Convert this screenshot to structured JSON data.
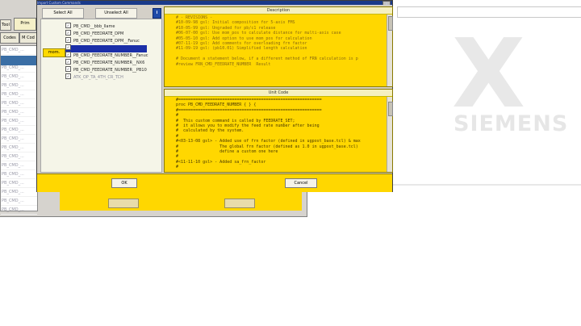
{
  "background_window": {
    "toolbar_left_label": "Tool",
    "prim_label": "Prim",
    "codes_label": "Codes",
    "mcod_label": "M Cod",
    "list_items": [
      "PB_CMD_...",
      "PB_CMD_...",
      "PB_CMD_...",
      "PB_CMD_...",
      "PB_CMD_...",
      "PB_CMD_...",
      "PB_CMD_...",
      "PB_CMD_...",
      "PB_CMD_...",
      "PB_CMD_...",
      "PB_CMD_...",
      "PB_CMD_...",
      "PB_CMD_...",
      "PB_CMD_...",
      "PB_CMD_...",
      "PB_CMD_...",
      "PB_CMD_...",
      "PB_CMD_...",
      "PB_CMD_..."
    ]
  },
  "watermark": {
    "x_text": "X",
    "brand_text": "SIEMENS"
  },
  "dialog": {
    "title": "Import Custom Commands",
    "close_label": "x",
    "toolbar": {
      "select_all": "Select All",
      "unselect_all": "Unselect All",
      "info_label": "i"
    },
    "tree_tag_label": "mom.",
    "tree_items": [
      {
        "label": "PB_CMD__bbb_llame",
        "checked": true
      },
      {
        "label": "PB_CMD_FEEDRATE_DPM",
        "checked": true
      },
      {
        "label": "PB_CMD_FEEDRATE_DPM__Fanuc",
        "checked": true
      },
      {
        "label": "",
        "checked": true,
        "highlighted": true
      },
      {
        "label": "PB_CMD_FEEDRATE_NUMBER__Fanuc",
        "checked": true
      },
      {
        "label": "PB_CMD_FEEDRATE_NUMBER__NX6",
        "checked": true
      },
      {
        "label": "PB_CMD_FEEDRATE_NUMBER__PB10",
        "checked": true
      },
      {
        "label": "ATK_OP_TA_4TH_CR_TCH",
        "checked": true,
        "faded": true
      }
    ],
    "desc_panel": {
      "title": "Description",
      "text": "# - REVISIONS -\n#10-09-98 gsl: Initial composition for 5-axis FMS\n#10-05-99 gsl: Ungraded for pb/c1 release\n#06-07-00 gsl: Use mom_pos to calculate distance for multi-axis case\n#05-05-10 gsl: Add option to use mom_pos for calculation\n#07-11-19 gsl: Add comments for overloading frn factor\n#11-09-19 gsl: (pb10.01) Simplified length calculation\n\n# Document a statement below, if a different method of FRN calculation is p\n#review FRN_CMD_FEEDRATE_NUMBER  Result"
    },
    "unit_panel": {
      "title": "Unit Code",
      "text": "#===========================================================\nproc PB_CMD_FEEDRATE_NUMBER { } {\n#===========================================================\n#\n#  This custom command is called by FEEDRATE_SET;\n#  it allows you to modify the feed rate number after being\n#  calculated by the system.\n#\n#<03-13-08 gsl> - Added use of frn factor (defined in ugpost_base.tcl) & max\n#                 The global frn factor (defined as 1.0 in ugpost_base.tcl)\n#                 define a custom one here\n#\n#<11-11-10 gsl> - Added sa_frn_factor\n#"
    },
    "ok_label": "OK",
    "cancel_label": "Cancel"
  }
}
